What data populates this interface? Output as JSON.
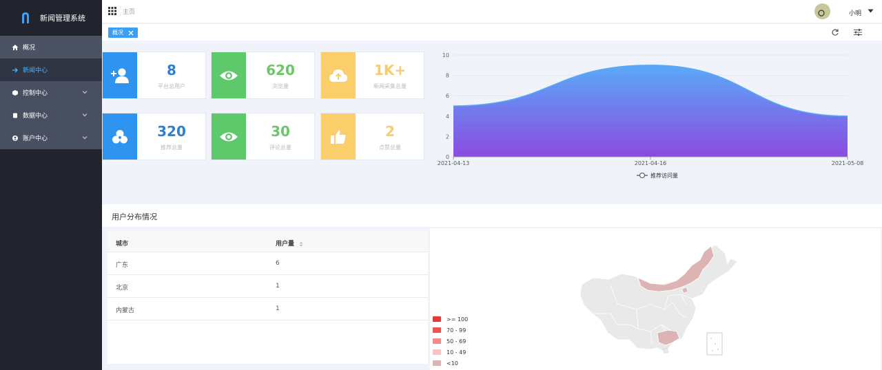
{
  "app": {
    "title": "新闻管理系统"
  },
  "sidebar": {
    "items": [
      {
        "label": "概况",
        "icon": "home-icon",
        "expandable": false
      },
      {
        "label": "新闻中心",
        "icon": "arrow-right-icon",
        "expandable": false,
        "active": true
      },
      {
        "label": "控制中心",
        "icon": "cube-icon",
        "expandable": true
      },
      {
        "label": "数据中心",
        "icon": "database-icon",
        "expandable": true
      },
      {
        "label": "账户中心",
        "icon": "account-icon",
        "expandable": true
      }
    ]
  },
  "topbar": {
    "breadcrumb": "主页",
    "username": "小明"
  },
  "tabs": [
    {
      "label": "概况",
      "closable": true
    }
  ],
  "stats": [
    {
      "value": "8",
      "label": "平台总用户",
      "icon": "add-user-icon",
      "color": "#2f94f0"
    },
    {
      "value": "620",
      "label": "浏览量",
      "icon": "eye-icon",
      "color": "#5dc96b"
    },
    {
      "value": "1K+",
      "label": "新闻采集总量",
      "icon": "cloud-upload-icon",
      "color": "#fbce6c"
    },
    {
      "value": "320",
      "label": "推荐总量",
      "icon": "cluster-icon",
      "color": "#2f94f0"
    },
    {
      "value": "30",
      "label": "评论总量",
      "icon": "eye-icon",
      "color": "#5dc96b"
    },
    {
      "value": "2",
      "label": "点赞总量",
      "icon": "thumbs-up-icon",
      "color": "#fbce6c"
    }
  ],
  "chart_data": {
    "type": "area",
    "x": [
      "2021-04-13",
      "2021-04-16",
      "2021-05-08"
    ],
    "series": [
      {
        "name": "推荐访问量",
        "values": [
          5,
          9,
          4
        ]
      }
    ],
    "ylim": [
      0,
      10
    ],
    "yticks": [
      0,
      2,
      4,
      6,
      8,
      10
    ],
    "legend": "bottom-center",
    "grid": true,
    "colors": {
      "top": "#5aa9f8",
      "bottom": "#8a4be0"
    }
  },
  "user_distribution": {
    "title": "用户分布情况",
    "columns": [
      "城市",
      "用户量"
    ],
    "rows": [
      {
        "city": "广东",
        "count": "6"
      },
      {
        "city": "北京",
        "count": "1"
      },
      {
        "city": "内蒙古",
        "count": "1"
      }
    ]
  },
  "map_legend": [
    {
      "label": ">= 100",
      "color": "#e53935"
    },
    {
      "label": "70 - 99",
      "color": "#ef5350"
    },
    {
      "label": "50 - 69",
      "color": "#f28b8b"
    },
    {
      "label": "10 - 49",
      "color": "#f8c3c3"
    },
    {
      "label": "<10",
      "color": "#deb3b3"
    }
  ]
}
